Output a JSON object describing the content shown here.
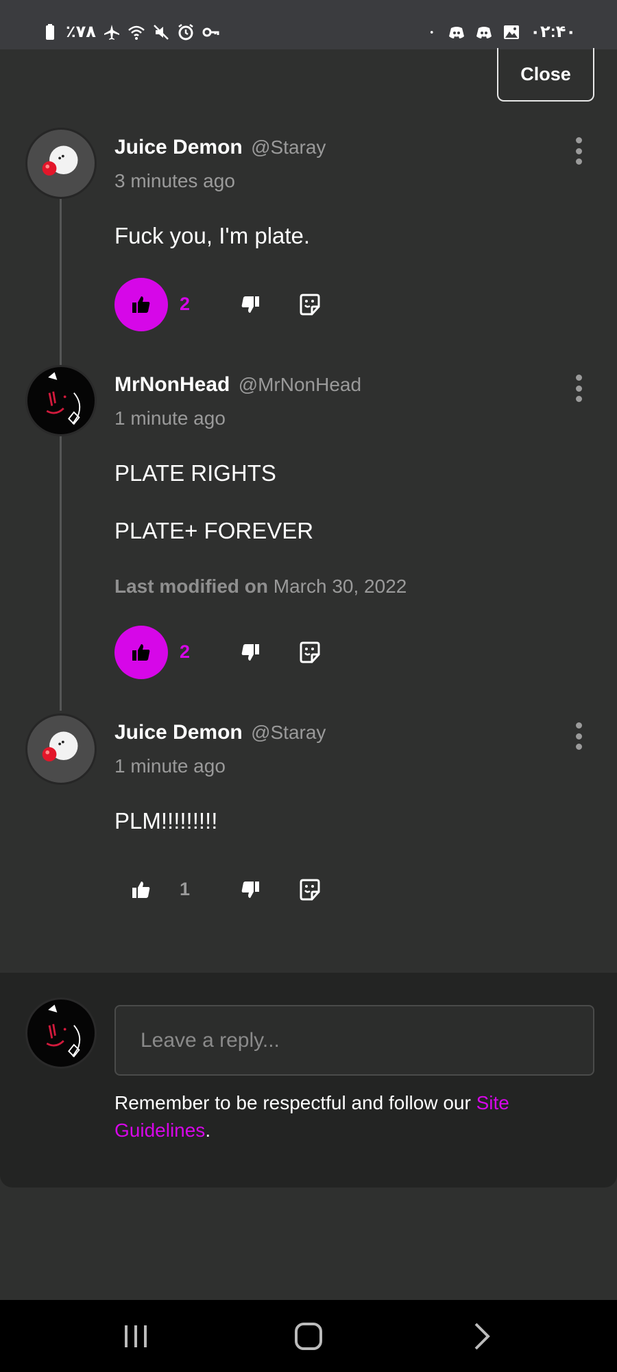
{
  "status_bar": {
    "battery_text": "٪۷۸",
    "clock": "۰۲:۴۰"
  },
  "close_label": "Close",
  "comments": [
    {
      "author": "Juice Demon",
      "handle": "@Staray",
      "time": "3 minutes ago",
      "lines": [
        "Fuck you, I'm plate."
      ],
      "likes": "2",
      "liked": true
    },
    {
      "author": "MrNonHead",
      "handle": "@MrNonHead",
      "time": "1 minute ago",
      "lines": [
        "PLATE RIGHTS",
        "PLATE+ FOREVER"
      ],
      "modified_label": "Last modified on",
      "modified_date": "March 30, 2022",
      "likes": "2",
      "liked": true
    },
    {
      "author": "Juice Demon",
      "handle": "@Staray",
      "time": "1 minute ago",
      "lines": [
        "PLM!!!!!!!!!"
      ],
      "likes": "1",
      "liked": false
    }
  ],
  "reply": {
    "placeholder": "Leave a reply...",
    "reminder_text": "Remember to be respectful and follow our ",
    "guidelines_link": "Site Guidelines",
    "reminder_end": "."
  },
  "colors": {
    "accent": "#d607e8",
    "background": "#2f302f",
    "panel": "#232423"
  },
  "icons": [
    "battery-icon",
    "airplane-icon",
    "wifi-icon",
    "mute-icon",
    "alarm-icon",
    "key-icon",
    "discord-icon",
    "gallery-icon",
    "thumbs-up-icon",
    "thumbs-down-icon",
    "sticker-icon",
    "more-options-icon",
    "recent-apps-icon",
    "home-icon",
    "back-icon"
  ]
}
